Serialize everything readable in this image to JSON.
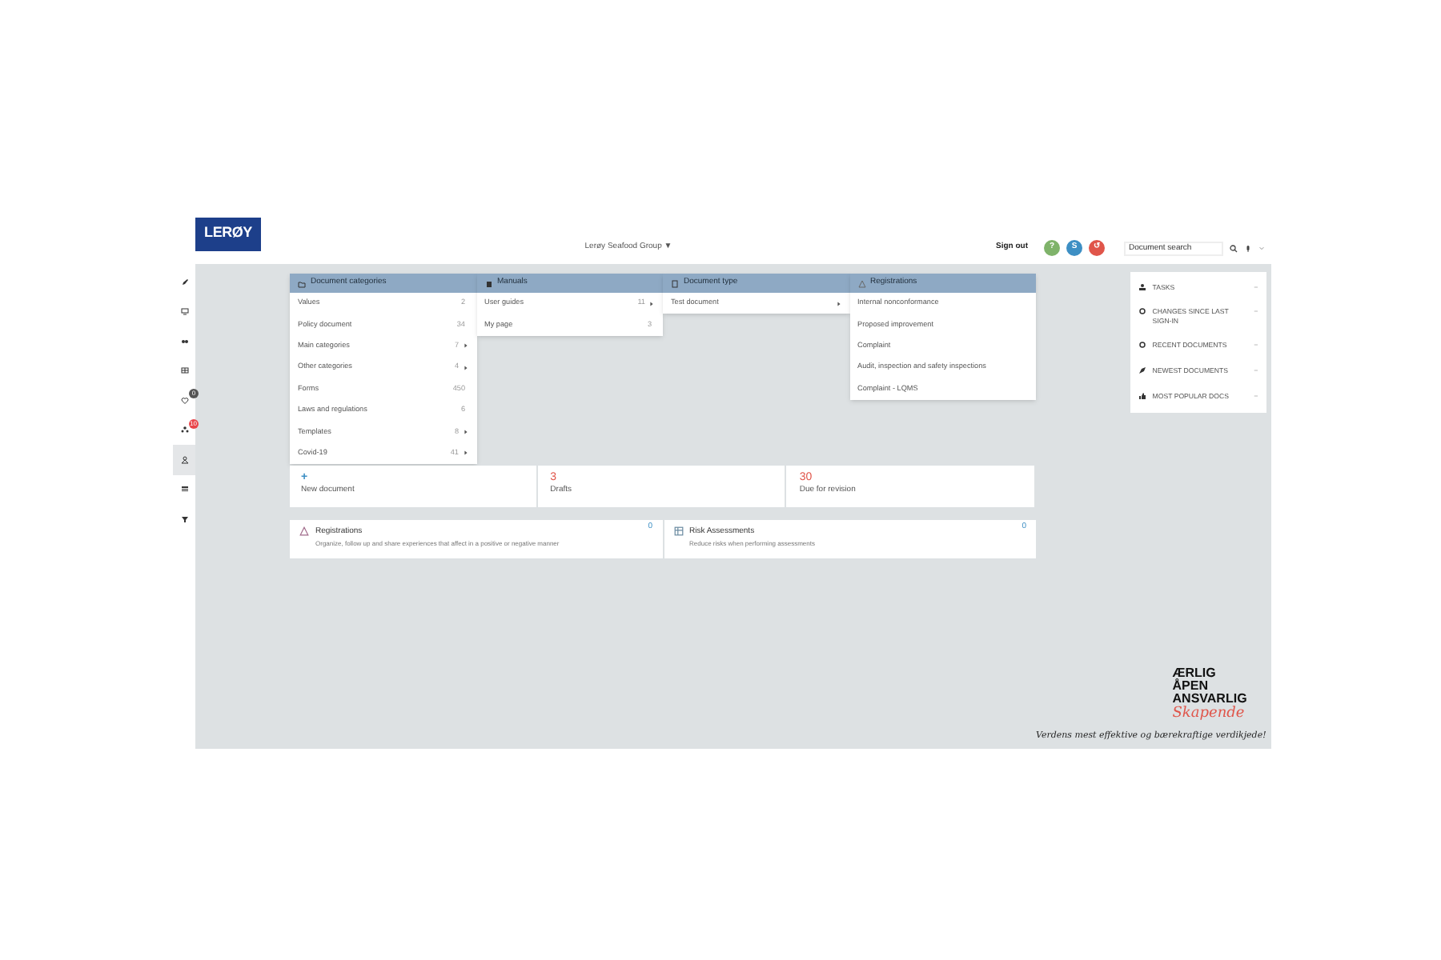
{
  "header": {
    "logo": "LERØY",
    "company": "Lerøy Seafood Group ▼",
    "sign_out": "Sign out",
    "help_buttons": [
      {
        "label": "?",
        "color": "#7fb36a"
      },
      {
        "label": "S",
        "color": "#3d8fc4"
      },
      {
        "label": "↺",
        "color": "#e0554a"
      }
    ],
    "search": {
      "placeholder": "Document search"
    }
  },
  "sidebar": {
    "items": [
      {
        "selected": false
      },
      {
        "selected": false
      },
      {
        "selected": false
      },
      {
        "selected": false
      },
      {
        "selected": false,
        "badge": {
          "text": "0",
          "color": "#555555"
        }
      },
      {
        "selected": false,
        "badge": {
          "text": "10",
          "color": "#e8454a"
        }
      },
      {
        "selected": true
      },
      {
        "selected": false
      },
      {
        "selected": false
      }
    ]
  },
  "menus": [
    {
      "title": "Document categories",
      "items": [
        {
          "label": "Values",
          "count": "2",
          "has_children": false
        },
        {
          "label": "Policy document",
          "count": "34",
          "has_children": false
        },
        {
          "label": "Main categories",
          "count": "7",
          "has_children": true
        },
        {
          "label": "Other categories",
          "count": "4",
          "has_children": true
        },
        {
          "label": "Forms",
          "count": "450",
          "has_children": false
        },
        {
          "label": "Laws and regulations",
          "count": "6",
          "has_children": false
        },
        {
          "label": "Templates",
          "count": "8",
          "has_children": true
        },
        {
          "label": "Covid-19",
          "count": "41",
          "has_children": true
        }
      ]
    },
    {
      "title": "Manuals",
      "items": [
        {
          "label": "User guides",
          "count": "11",
          "has_children": true
        },
        {
          "label": "My page",
          "count": "3",
          "has_children": false
        }
      ]
    },
    {
      "title": "Document type",
      "items": [
        {
          "label": "Test document",
          "has_children": true
        }
      ]
    },
    {
      "title": "Registrations",
      "items": [
        {
          "label": "Internal nonconformance",
          "has_children": false
        },
        {
          "label": "Proposed improvement",
          "has_children": false
        },
        {
          "label": "Complaint",
          "has_children": false
        },
        {
          "label": "Audit, inspection and safety inspections",
          "has_children": false
        },
        {
          "label": "Complaint - LQMS",
          "has_children": false
        }
      ]
    }
  ],
  "stats": [
    {
      "value": "+",
      "label": "New document",
      "kind": "action"
    },
    {
      "value": "3",
      "label": "Drafts",
      "kind": "count"
    },
    {
      "value": "30",
      "label": "Due for revision",
      "kind": "count"
    }
  ],
  "modules": [
    {
      "title": "Registrations",
      "description": "Organize, follow up and share experiences that affect in a positive or negative manner",
      "count": "0"
    },
    {
      "title": "Risk Assessments",
      "description": "Reduce risks when performing assessments",
      "count": "0"
    }
  ],
  "right_panel": {
    "items": [
      {
        "label": "TASKS",
        "toggle": "−"
      },
      {
        "label": "CHANGES SINCE LAST SIGN-IN",
        "toggle": "−"
      },
      {
        "label": "RECENT DOCUMENTS",
        "toggle": "−"
      },
      {
        "label": "NEWEST DOCUMENTS",
        "toggle": "−"
      },
      {
        "label": "MOST POPULAR DOCS",
        "toggle": "−"
      }
    ]
  },
  "slogan": {
    "values": [
      "ÆRLIG",
      "ÅPEN",
      "ANSVARLIG"
    ],
    "script_word": "Skapende",
    "tagline": "Verdens mest effektive og bærekraftige verdikjede!"
  }
}
